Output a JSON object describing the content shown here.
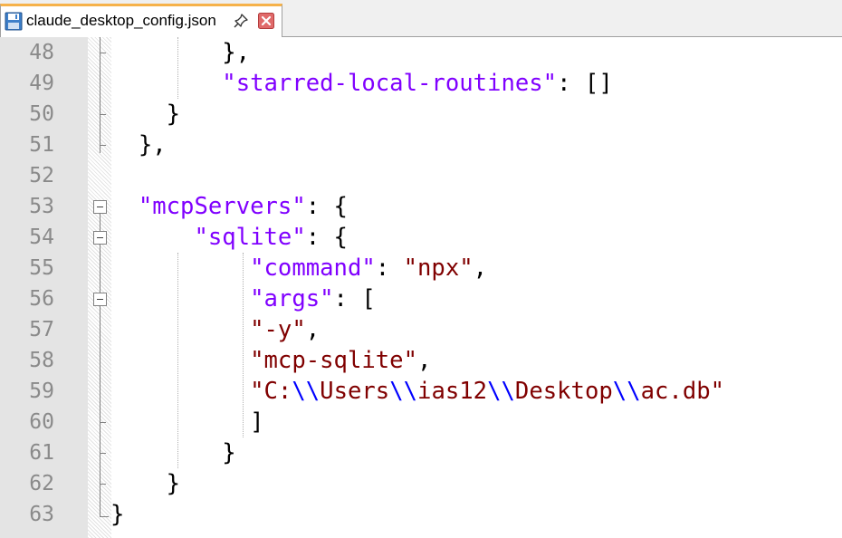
{
  "tab": {
    "title": "claude_desktop_config.json",
    "icons": [
      "save-icon",
      "pin-icon",
      "close-icon"
    ]
  },
  "colors": {
    "key": "#8000ff",
    "string": "#800000",
    "escape": "#0000ff",
    "punctuation": "#000000",
    "line_numbers": "#8a8a8a",
    "tab_accent": "#f6b24a"
  },
  "editor": {
    "lines": [
      {
        "n": "48",
        "parts": [
          {
            "t": "p",
            "v": "        },"
          }
        ]
      },
      {
        "n": "49",
        "parts": [
          {
            "t": "p",
            "v": "        "
          },
          {
            "t": "key",
            "v": "\"starred-local-routines\""
          },
          {
            "t": "p",
            "v": ": []"
          }
        ]
      },
      {
        "n": "50",
        "parts": [
          {
            "t": "p",
            "v": "    }"
          }
        ]
      },
      {
        "n": "51",
        "parts": [
          {
            "t": "p",
            "v": "  },"
          }
        ]
      },
      {
        "n": "52",
        "parts": []
      },
      {
        "n": "53",
        "parts": [
          {
            "t": "p",
            "v": "  "
          },
          {
            "t": "key",
            "v": "\"mcpServers\""
          },
          {
            "t": "p",
            "v": ": {"
          }
        ]
      },
      {
        "n": "54",
        "parts": [
          {
            "t": "p",
            "v": "      "
          },
          {
            "t": "key",
            "v": "\"sqlite\""
          },
          {
            "t": "p",
            "v": ": {"
          }
        ]
      },
      {
        "n": "55",
        "parts": [
          {
            "t": "p",
            "v": "          "
          },
          {
            "t": "key",
            "v": "\"command\""
          },
          {
            "t": "p",
            "v": ": "
          },
          {
            "t": "str",
            "v": "\"npx\""
          },
          {
            "t": "p",
            "v": ","
          }
        ]
      },
      {
        "n": "56",
        "parts": [
          {
            "t": "p",
            "v": "          "
          },
          {
            "t": "key",
            "v": "\"args\""
          },
          {
            "t": "p",
            "v": ": ["
          }
        ]
      },
      {
        "n": "57",
        "parts": [
          {
            "t": "p",
            "v": "          "
          },
          {
            "t": "str",
            "v": "\"-y\""
          },
          {
            "t": "p",
            "v": ","
          }
        ]
      },
      {
        "n": "58",
        "parts": [
          {
            "t": "p",
            "v": "          "
          },
          {
            "t": "str",
            "v": "\"mcp-sqlite\""
          },
          {
            "t": "p",
            "v": ","
          }
        ]
      },
      {
        "n": "59",
        "parts": [
          {
            "t": "p",
            "v": "          "
          },
          {
            "t": "str",
            "v": "\"C:"
          },
          {
            "t": "esc",
            "v": "\\\\"
          },
          {
            "t": "str",
            "v": "Users"
          },
          {
            "t": "esc",
            "v": "\\\\"
          },
          {
            "t": "str",
            "v": "ias12"
          },
          {
            "t": "esc",
            "v": "\\\\"
          },
          {
            "t": "str",
            "v": "Desktop"
          },
          {
            "t": "esc",
            "v": "\\\\"
          },
          {
            "t": "str",
            "v": "ac.db\""
          }
        ]
      },
      {
        "n": "60",
        "parts": [
          {
            "t": "p",
            "v": "          ]"
          }
        ]
      },
      {
        "n": "61",
        "parts": [
          {
            "t": "p",
            "v": "        }"
          }
        ]
      },
      {
        "n": "62",
        "parts": [
          {
            "t": "p",
            "v": "    }"
          }
        ]
      },
      {
        "n": "63",
        "parts": [
          {
            "t": "p",
            "v": "}"
          }
        ]
      }
    ]
  }
}
